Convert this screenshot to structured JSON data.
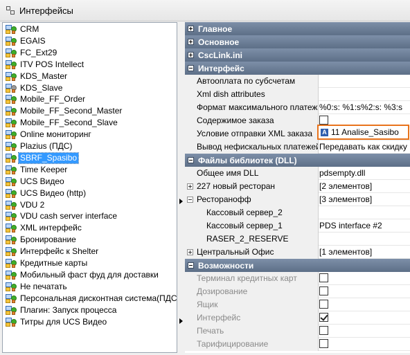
{
  "window": {
    "title": "Интерфейсы"
  },
  "tree": {
    "items": [
      {
        "label": "CRM"
      },
      {
        "label": "EGAIS"
      },
      {
        "label": "FC_Ext29"
      },
      {
        "label": "ITV POS Intellect"
      },
      {
        "label": "KDS_Master"
      },
      {
        "label": "KDS_Slave"
      },
      {
        "label": "Mobile_FF_Order"
      },
      {
        "label": "Mobile_FF_Second_Master"
      },
      {
        "label": "Mobile_FF_Second_Slave"
      },
      {
        "label": "Online мониторинг"
      },
      {
        "label": "Plazius (ПДС)"
      },
      {
        "label": "SBRF_Spasibo"
      },
      {
        "label": "Time Keeper"
      },
      {
        "label": "UCS Видео"
      },
      {
        "label": "UCS Видео (http)"
      },
      {
        "label": "VDU 2"
      },
      {
        "label": "VDU cash server interface"
      },
      {
        "label": "XML интерфейс"
      },
      {
        "label": "Бронирование"
      },
      {
        "label": "Интерфейс к Shelter"
      },
      {
        "label": "Кредитные карты"
      },
      {
        "label": "Мобильный фаст фуд для доставки"
      },
      {
        "label": "Не печатать"
      },
      {
        "label": "Персональная дисконтная система(ПДС)"
      },
      {
        "label": "Плагин: Запуск процесса"
      },
      {
        "label": "Титры для UCS Видео"
      }
    ],
    "selected": "SBRF_Spasibo"
  },
  "props": {
    "cat_main": "Главное",
    "cat_basic": "Основное",
    "cat_csclink": "CscLink.ini",
    "cat_interface": "Интерфейс",
    "autopay": {
      "name": "Автооплата по субсчетам",
      "value": ""
    },
    "xmldish": {
      "name": "Xml dish attributes",
      "value": ""
    },
    "format": {
      "name": "Формат максимального платежа",
      "value": "%0:s: %1:s%2:s: %3:s"
    },
    "content": {
      "name": "Содержимое заказа",
      "checked": false
    },
    "xmlcond": {
      "name": "Условие отправки XML заказа",
      "icon": "A",
      "value": "11 Analise_Sasibo"
    },
    "nonfiscal": {
      "name": "Вывод нефискальных платежей в",
      "value": "Передавать как скидку"
    },
    "cat_dll": "Файлы библиотек (DLL)",
    "dllname": {
      "name": "Общее имя DLL",
      "value": "pdsempty.dll"
    },
    "rest227": {
      "name": "227 новый ресторан",
      "value": "[2 элементов]"
    },
    "restoff": {
      "name": "Ресторанофф",
      "value": "[3 элементов]"
    },
    "cashsrv2": {
      "name": "Кассовый сервер_2",
      "value": ""
    },
    "cashsrv1": {
      "name": "Кассовый сервер_1",
      "value": "PDS interface #2"
    },
    "raser": {
      "name": "RASER_2_RESERVE",
      "value": ""
    },
    "central": {
      "name": "Центральный Офис",
      "value": "[1 элементов]"
    },
    "cat_caps": "Возможности",
    "caps": [
      {
        "name": "Терминал кредитных карт",
        "checked": false
      },
      {
        "name": "Дозирование",
        "checked": false
      },
      {
        "name": "Ящик",
        "checked": false
      },
      {
        "name": "Интерфейс",
        "checked": true
      },
      {
        "name": "Печать",
        "checked": false
      },
      {
        "name": "Тарифицирование",
        "checked": false
      }
    ]
  }
}
